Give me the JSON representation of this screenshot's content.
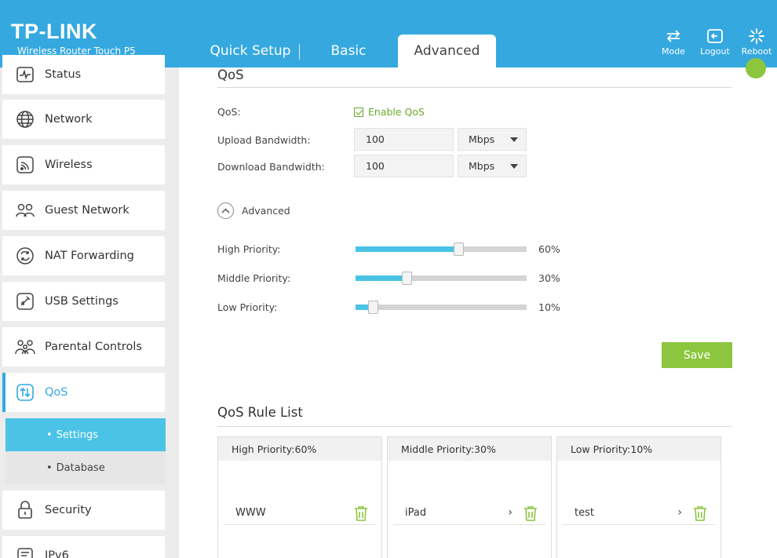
{
  "header": {
    "brand": "TP-LINK",
    "model": "Wireless Router Touch P5",
    "tabs": [
      {
        "label": "Quick Setup"
      },
      {
        "label": "Basic"
      },
      {
        "label": "Advanced"
      }
    ],
    "buttons": {
      "mode": "Mode",
      "logout": "Logout",
      "reboot": "Reboot"
    }
  },
  "sidebar": {
    "items": [
      {
        "label": "Status"
      },
      {
        "label": "Network"
      },
      {
        "label": "Wireless"
      },
      {
        "label": "Guest Network"
      },
      {
        "label": "NAT Forwarding"
      },
      {
        "label": "USB Settings"
      },
      {
        "label": "Parental Controls"
      },
      {
        "label": "QoS"
      },
      {
        "label": "Security"
      },
      {
        "label": "IPv6"
      }
    ],
    "sub_items": [
      {
        "label": "Settings"
      },
      {
        "label": "Database"
      }
    ],
    "bullet": "•"
  },
  "qos": {
    "title": "QoS",
    "qos_label": "QoS:",
    "enable_label": "Enable QoS",
    "upload_label": "Upload Bandwidth:",
    "upload_value": "100",
    "upload_unit": "Mbps",
    "download_label": "Download Bandwidth:",
    "download_value": "100",
    "download_unit": "Mbps",
    "advanced_label": "Advanced",
    "priorities": [
      {
        "label": "High Priority:",
        "percent_text": "60%",
        "value": 60
      },
      {
        "label": "Middle Priority:",
        "percent_text": "30%",
        "value": 30
      },
      {
        "label": "Low Priority:",
        "percent_text": "10%",
        "value": 10
      }
    ],
    "save_label": "Save"
  },
  "rule_list": {
    "title": "QoS Rule List",
    "cards": [
      {
        "header": "High Priority:60%",
        "entry": "WWW",
        "has_arrow": false
      },
      {
        "header": "Middle Priority:30%",
        "entry": "iPad",
        "has_arrow": true
      },
      {
        "header": "Low Priority:10%",
        "entry": "test",
        "has_arrow": true
      }
    ],
    "arrow": "›"
  },
  "colors": {
    "brand_blue": "#35a8e0",
    "accent_cyan": "#4ac3e6",
    "success_green": "#8cc63f"
  }
}
